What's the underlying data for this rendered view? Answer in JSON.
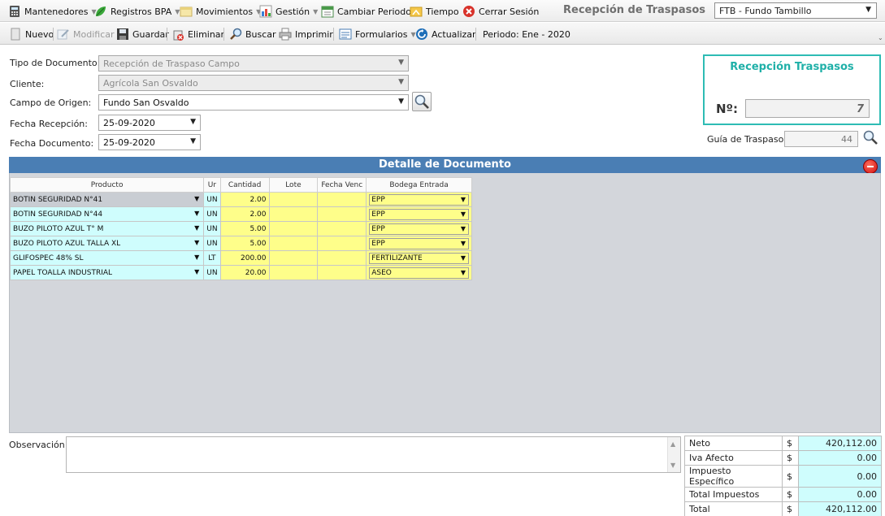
{
  "menubar": {
    "items": [
      {
        "label": "Mantenedores",
        "icon": "calculator-icon"
      },
      {
        "label": "Registros BPA",
        "icon": "leaf-icon"
      },
      {
        "label": "Movimientos",
        "icon": "document-icon"
      },
      {
        "label": "Gestión",
        "icon": "chart-icon"
      },
      {
        "label": "Cambiar Periodo",
        "icon": "calendar-icon"
      },
      {
        "label": "Tiempo",
        "icon": "folder-icon"
      },
      {
        "label": "Cerrar Sesión",
        "icon": "close-circle-icon"
      }
    ],
    "window_title": "Recepción de Traspasos",
    "fundo": "FTB - Fundo Tambillo"
  },
  "toolbar": {
    "nuevo": "Nuevo",
    "modificar": "Modificar",
    "guardar": "Guardar",
    "eliminar": "Eliminar",
    "buscar": "Buscar",
    "imprimir": "Imprimir",
    "formularios": "Formularios",
    "actualizar": "Actualizar",
    "periodo": "Periodo: Ene - 2020"
  },
  "form": {
    "tipo_label": "Tipo de Documento:",
    "tipo_value": "Recepción de Traspaso Campo",
    "cliente_label": "Cliente:",
    "cliente_value": "Agrícola San Osvaldo",
    "campo_label": "Campo de Origen:",
    "campo_value": "Fundo San Osvaldo",
    "fecha_recepcion_label": "Fecha Recepción:",
    "fecha_recepcion_value": "25-09-2020",
    "fecha_documento_label": "Fecha Documento:",
    "fecha_documento_value": "25-09-2020"
  },
  "recepcion": {
    "title": "Recepción Traspasos",
    "no_label": "Nº:",
    "no_value": "7",
    "guia_label": "Guía de Traspaso:",
    "guia_value": "44"
  },
  "detalle": {
    "title": "Detalle de Documento",
    "headers": [
      "Producto",
      "Ur",
      "Cantidad",
      "Lote",
      "Fecha Venc",
      "Bodega Entrada"
    ],
    "rows": [
      {
        "producto": "BOTIN SEGURIDAD N°41",
        "un": "UN",
        "cantidad": "2.00",
        "lote": "",
        "fecha": "",
        "bodega": "EPP"
      },
      {
        "producto": "BOTIN SEGURIDAD N°44",
        "un": "UN",
        "cantidad": "2.00",
        "lote": "",
        "fecha": "",
        "bodega": "EPP"
      },
      {
        "producto": "BUZO PILOTO AZUL T° M",
        "un": "UN",
        "cantidad": "5.00",
        "lote": "",
        "fecha": "",
        "bodega": "EPP"
      },
      {
        "producto": "BUZO PILOTO AZUL TALLA XL",
        "un": "UN",
        "cantidad": "5.00",
        "lote": "",
        "fecha": "",
        "bodega": "EPP"
      },
      {
        "producto": "GLIFOSPEC 48% SL",
        "un": "LT",
        "cantidad": "200.00",
        "lote": "",
        "fecha": "",
        "bodega": "FERTILIZANTE"
      },
      {
        "producto": "PAPEL TOALLA INDUSTRIAL",
        "un": "UN",
        "cantidad": "20.00",
        "lote": "",
        "fecha": "",
        "bodega": "ASEO"
      }
    ]
  },
  "observacion_label": "Observación:",
  "totals": [
    {
      "label": "Neto",
      "currency": "$",
      "value": "420,112.00"
    },
    {
      "label": "Iva Afecto",
      "currency": "$",
      "value": "0.00"
    },
    {
      "label": "Impuesto Específico",
      "currency": "$",
      "value": "0.00"
    },
    {
      "label": "Total Impuestos",
      "currency": "$",
      "value": "0.00"
    },
    {
      "label": "Total",
      "currency": "$",
      "value": "420,112.00"
    }
  ],
  "colors": {
    "accent": "#1fb0a8",
    "panel_header": "#4a7eb4",
    "cell_cyan": "#cffdfd",
    "cell_yellow": "#fefe8a"
  }
}
